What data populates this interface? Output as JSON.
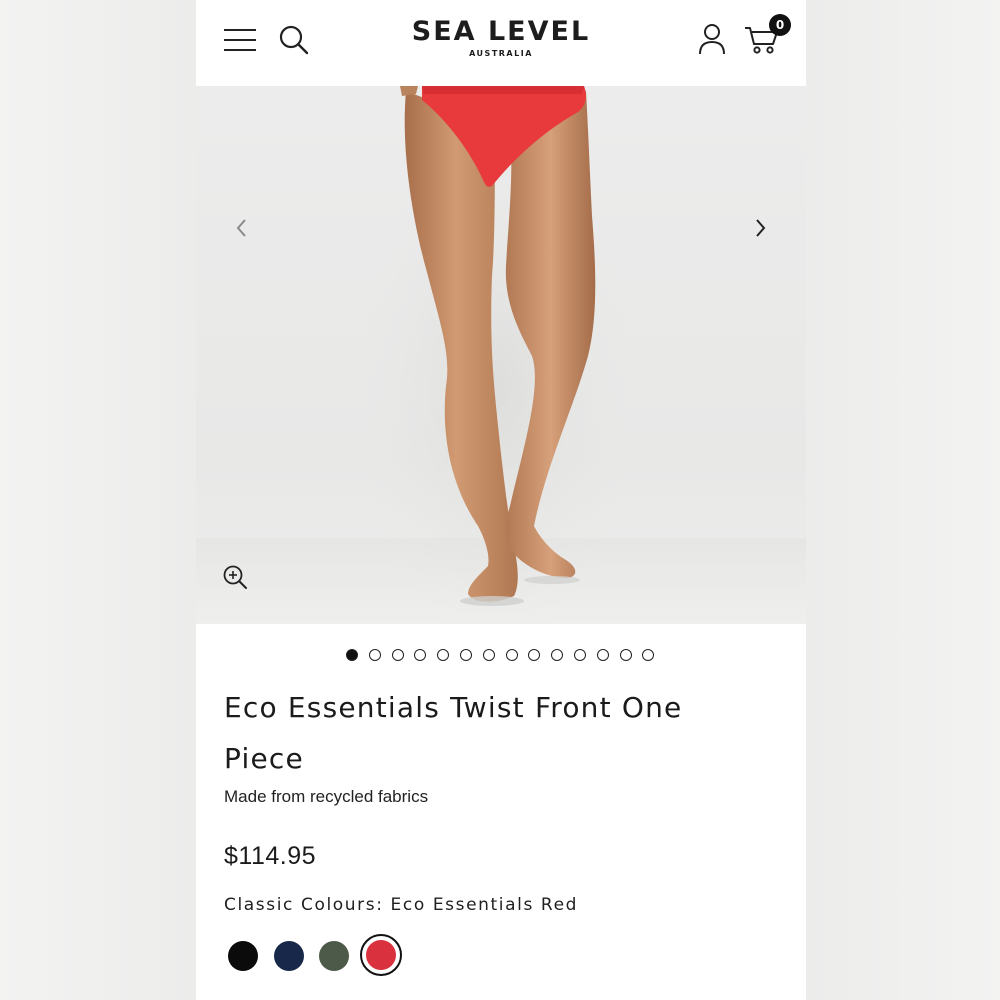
{
  "brand": {
    "name": "SEA LEVEL",
    "tagline": "AUSTRALIA"
  },
  "header": {
    "cart_count": "0",
    "icons": [
      "menu-icon",
      "search-icon",
      "account-icon",
      "cart-icon"
    ]
  },
  "gallery": {
    "image_count": 14,
    "active_index": 0,
    "icons": [
      "chevron-left-icon",
      "chevron-right-icon",
      "zoom-in-icon"
    ]
  },
  "product": {
    "title": "Eco Essentials Twist Front One Piece",
    "subtitle": "Made from recycled fabrics",
    "price": "$114.95",
    "colour_line": "Classic Colours: Eco Essentials Red",
    "swatches": [
      {
        "color": "#0b0b0b",
        "selected": false
      },
      {
        "color": "#17284a",
        "selected": false
      },
      {
        "color": "#4d5a49",
        "selected": false
      },
      {
        "color": "#d9313d",
        "selected": true
      }
    ]
  },
  "colors": {
    "swimsuit": "#e83a3c",
    "skin": "#c98f67",
    "background": "#ebebea"
  }
}
